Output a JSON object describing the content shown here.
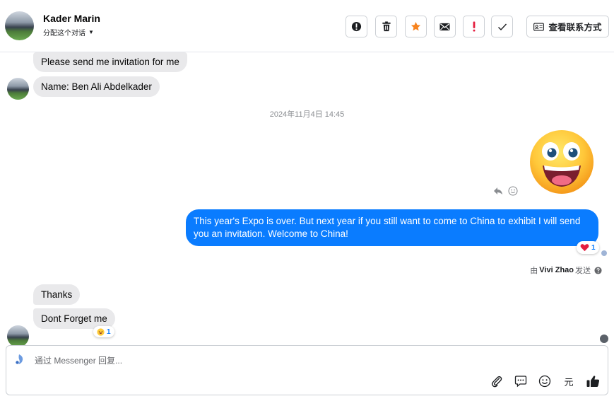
{
  "header": {
    "contact_name": "Kader Marin",
    "assign_label": "分配这个对话",
    "view_contact_label": "查看联系方式"
  },
  "toolbar": {
    "buttons": [
      "alert-circle-icon",
      "trash-icon",
      "star-icon",
      "envelope-icon",
      "exclamation-icon",
      "check-icon"
    ]
  },
  "messages": {
    "incoming_1": "Please send me invitation for me",
    "incoming_2": "Name: Ben Ali Abdelkader",
    "timestamp": "2024年11月4日 14:45",
    "outgoing_text": "This year's Expo is over. But next year if you still want to come to China to exhibit I will send you an invitation. Welcome to China!",
    "outgoing_reaction_count": "1",
    "sender_prefix": "由",
    "sender_name": "Vivi Zhao",
    "sender_suffix": "发送",
    "incoming_3": "Thanks",
    "incoming_4": "Dont Forget me",
    "incoming_reaction_count": "1"
  },
  "composer": {
    "placeholder": "通过 Messenger 回复...",
    "tools": [
      "paperclip-icon",
      "chat-bubble-icon",
      "smile-icon",
      "currency-yuan-icon",
      "thumbs-up-icon"
    ],
    "yuan_glyph": "元"
  },
  "colors": {
    "accent": "#0a7cff",
    "incoming_bubble": "#e9e9eb",
    "star": "#f7831e",
    "alert_red": "#e41e3f"
  }
}
